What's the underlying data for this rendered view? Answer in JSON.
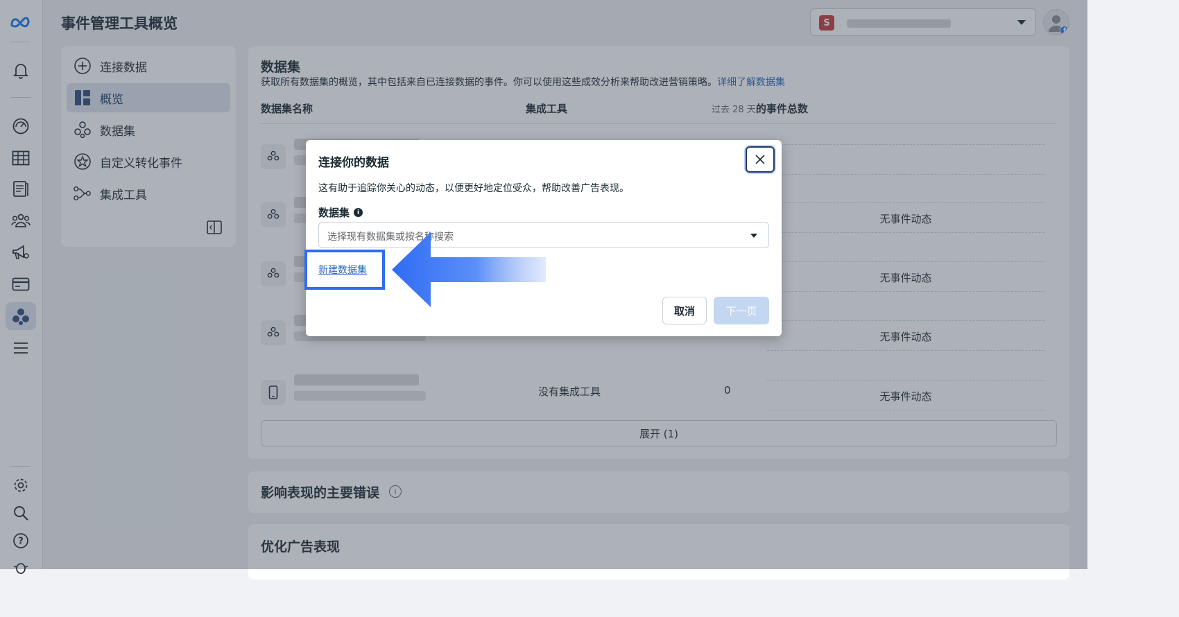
{
  "page": {
    "title": "事件管理工具概览"
  },
  "account": {
    "badge_letter": "S"
  },
  "rail": {
    "icons": [
      "meta-logo-icon",
      "bell-icon",
      "dashboard-icon",
      "table-icon",
      "document-icon",
      "people-icon",
      "megaphone-icon",
      "billing-card-icon",
      "events-manager-icon",
      "menu-icon",
      "settings-icon",
      "search-icon",
      "help-icon",
      "bug-icon"
    ]
  },
  "sidebar": {
    "items": [
      {
        "label": "连接数据",
        "icon": "plus-circle-icon"
      },
      {
        "label": "概览",
        "icon": "overview-grid-icon"
      },
      {
        "label": "数据集",
        "icon": "dataset-icon"
      },
      {
        "label": "自定义转化事件",
        "icon": "star-circle-icon"
      },
      {
        "label": "集成工具",
        "icon": "integration-icon"
      }
    ]
  },
  "datasets": {
    "title": "数据集",
    "description": "获取所有数据集的概览，其中包括来自已连接数据的事件。你可以使用这些成效分析来帮助改进营销策略。",
    "learn_more": "详细了解数据集",
    "columns": {
      "name": "数据集名称",
      "integration": "集成工具",
      "events_prefix": "过去 28 天",
      "events": "的事件总数"
    },
    "rows": [
      {
        "integration": "",
        "events": "",
        "activity": ""
      },
      {
        "integration": "",
        "events": "",
        "activity": "无事件动态"
      },
      {
        "integration": "",
        "events": "",
        "activity": "无事件动态"
      },
      {
        "integration": "",
        "events": "",
        "activity": "无事件动态"
      },
      {
        "integration": "没有集成工具",
        "events": "0",
        "activity": "无事件动态"
      }
    ],
    "expand_label": "展开 (1)"
  },
  "issues": {
    "title": "影响表现的主要错误"
  },
  "optimize": {
    "title": "优化广告表现"
  },
  "modal": {
    "title": "连接你的数据",
    "description": "这有助于追踪你关心的动态，以便更好地定位受众，帮助改善广告表现。",
    "dataset_label": "数据集",
    "select_placeholder": "选择现有数据集或按名称搜索",
    "new_dataset_link": "新建数据集",
    "cancel": "取消",
    "next": "下一页"
  },
  "colors": {
    "highlight": "#2f6cf5",
    "link": "#2a65c4",
    "next_disabled": "#c3d6f2"
  }
}
